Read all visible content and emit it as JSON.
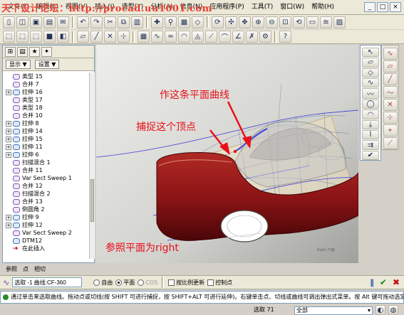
{
  "window": {
    "title_watermark": "天下设计论坛：http://procad.uu1001.com"
  },
  "menu": [
    "文件(F)",
    "编辑(E)",
    "视图(V)",
    "插入(I)",
    "造型(Y)",
    "分析(A)",
    "信息(N)",
    "应用程序(P)",
    "工具(T)",
    "窗口(W)",
    "帮助(H)"
  ],
  "left_panel": {
    "show_menu": "显示 ▼",
    "settings_menu": "设置 ▼",
    "tree": [
      {
        "label": "类型 15",
        "exp": false,
        "icon": "sweep"
      },
      {
        "label": "合并 7",
        "exp": false,
        "icon": "merge"
      },
      {
        "label": "拉伸 16",
        "exp": true,
        "icon": "ext"
      },
      {
        "label": "类型 17",
        "exp": false,
        "icon": "sweep"
      },
      {
        "label": "类型 18",
        "exp": false,
        "icon": "sweep"
      },
      {
        "label": "合并 10",
        "exp": false,
        "icon": "merge"
      },
      {
        "label": "拉伸 8",
        "exp": true,
        "icon": "ext"
      },
      {
        "label": "拉伸 14",
        "exp": true,
        "icon": "ext"
      },
      {
        "label": "拉伸 15",
        "exp": true,
        "icon": "ext"
      },
      {
        "label": "拉伸 11",
        "exp": true,
        "icon": "ext"
      },
      {
        "label": "拉伸 6",
        "exp": true,
        "icon": "ext"
      },
      {
        "label": "扫描混合 1",
        "exp": false,
        "icon": "sweep"
      },
      {
        "label": "合并 11",
        "exp": false,
        "icon": "merge"
      },
      {
        "label": "Var Sect Sweep 1",
        "exp": false,
        "icon": "sweep"
      },
      {
        "label": "合并 12",
        "exp": false,
        "icon": "merge"
      },
      {
        "label": "扫描混合 2",
        "exp": false,
        "icon": "sweep"
      },
      {
        "label": "合并 13",
        "exp": false,
        "icon": "merge"
      },
      {
        "label": "倒圆角 2",
        "exp": false,
        "icon": "sweep"
      },
      {
        "label": "拉伸 9",
        "exp": true,
        "icon": "ext"
      },
      {
        "label": "拉伸 12",
        "exp": true,
        "icon": "ext"
      },
      {
        "label": "Var Sect Sweep 2",
        "exp": false,
        "icon": "sweep"
      },
      {
        "label": "DTM12",
        "exp": false,
        "icon": "ext"
      },
      {
        "label": "在此插入",
        "exp": false,
        "icon": "arrow"
      }
    ]
  },
  "annotations": {
    "make_curve": "作这条平面曲线",
    "snap_vertex": "捕捉这个顶点",
    "ref_plane": "参照平面为right"
  },
  "dashboard_tabs": [
    "参照",
    "点",
    "相切"
  ],
  "dashboard": {
    "curve_field": "选取 -1 曲线:CF-360",
    "radio_free": "自由",
    "radio_plane": "平面",
    "radio_cos": "COS",
    "check_proportional": "按比例更新",
    "check_control_points": "控制点"
  },
  "message": "通过单击来选取曲线。拖动点或切线(按 SHIFT 可进行捕捉，按 SHIFT+ALT 可进行延伸)。右键单击点、切线或曲线可调出弹出式菜单。按 Alt 键可拖动选定平面曲线的",
  "status": {
    "selected": "选取 71",
    "filter": "全部"
  },
  "colors": {
    "car_body": "#8e1416",
    "annotation": "#e8101a"
  }
}
